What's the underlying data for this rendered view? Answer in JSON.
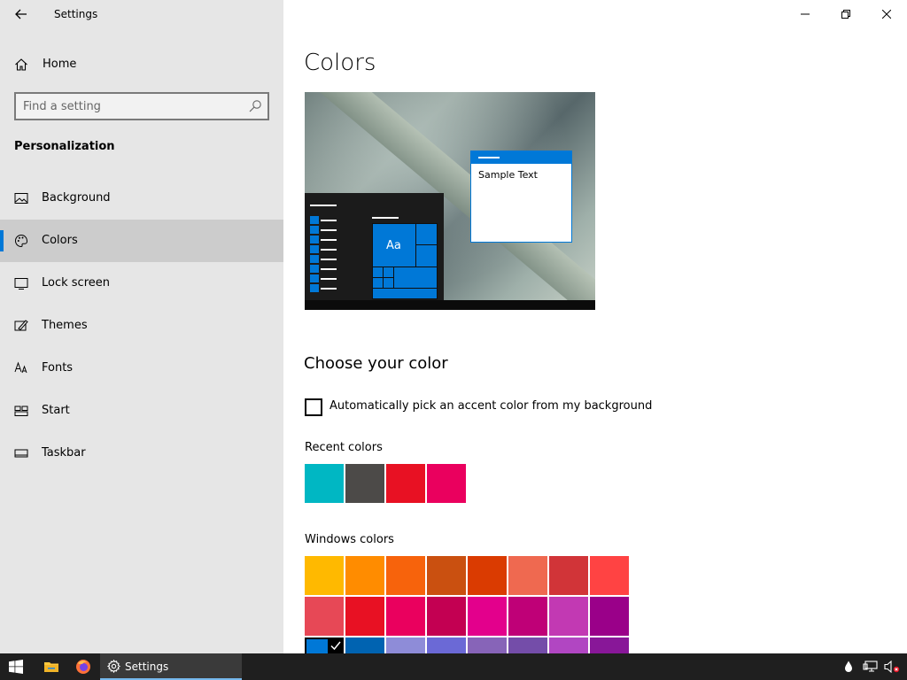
{
  "window": {
    "title": "Settings",
    "back_icon": "back-arrow-icon",
    "controls": [
      "minimize-icon",
      "restore-icon",
      "close-icon"
    ]
  },
  "sidebar": {
    "home_label": "Home",
    "search_placeholder": "Find a setting",
    "section_title": "Personalization",
    "items": [
      {
        "label": "Background",
        "icon": "picture-icon",
        "selected": false
      },
      {
        "label": "Colors",
        "icon": "palette-icon",
        "selected": true
      },
      {
        "label": "Lock screen",
        "icon": "lock-screen-icon",
        "selected": false
      },
      {
        "label": "Themes",
        "icon": "themes-icon",
        "selected": false
      },
      {
        "label": "Fonts",
        "icon": "fonts-icon",
        "selected": false
      },
      {
        "label": "Start",
        "icon": "start-icon",
        "selected": false
      },
      {
        "label": "Taskbar",
        "icon": "taskbar-icon",
        "selected": false
      }
    ]
  },
  "main": {
    "title": "Colors",
    "preview": {
      "sample_text": "Sample Text",
      "tile_text": "Aa"
    },
    "choose_heading": "Choose your color",
    "auto_pick_label": "Automatically pick an accent color from my background",
    "auto_pick_checked": false,
    "recent_label": "Recent colors",
    "recent_colors": [
      "#00b7c3",
      "#4c4a48",
      "#e81123",
      "#ea005e"
    ],
    "windows_label": "Windows colors",
    "windows_colors": [
      [
        "#ffb900",
        "#ff8c00",
        "#f7630c",
        "#ca5010",
        "#da3b01",
        "#ef6950",
        "#d13438",
        "#ff4343"
      ],
      [
        "#e74856",
        "#e81123",
        "#ea005e",
        "#c30052",
        "#e3008c",
        "#bf0077",
        "#c239b3",
        "#9a0089"
      ],
      [
        "#0078d7",
        "#0063b1",
        "#8e8cd8",
        "#6b69d6",
        "#8764b8",
        "#744da9",
        "#b146c2",
        "#881798"
      ]
    ],
    "selected_color": "#0078d7"
  },
  "taskbar": {
    "active_app_label": "Settings",
    "pinned": [
      "windows-start-icon",
      "file-explorer-icon",
      "firefox-icon"
    ],
    "tray": [
      "droplet-icon",
      "network-icon",
      "volume-muted-icon"
    ]
  }
}
